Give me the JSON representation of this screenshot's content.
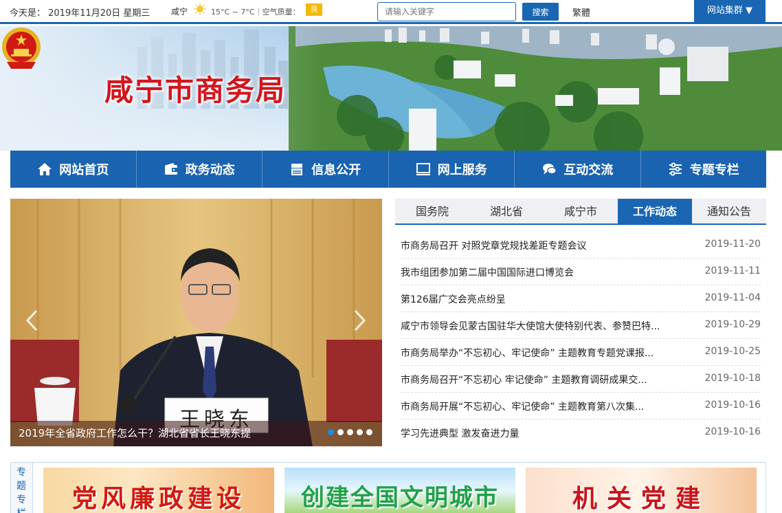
{
  "topbar": {
    "today": "今天是： 2019年11月20日 星期三",
    "city": "咸宁",
    "weather_icon": "sun-icon",
    "temp_aqi": "15°C ~ 7°C｜空气质量：",
    "aqi": "良",
    "search_placeholder": "请输入关键字",
    "search_button": "搜索",
    "traditional": "繁體",
    "site_group": "网站集群 ▼"
  },
  "banner": {
    "title": "咸宁市商务局"
  },
  "nav": [
    {
      "label": "网站首页",
      "icon": "home-icon"
    },
    {
      "label": "政务动态",
      "icon": "wallet-icon"
    },
    {
      "label": "信息公开",
      "icon": "server-icon"
    },
    {
      "label": "网上服务",
      "icon": "monitor-icon"
    },
    {
      "label": "互动交流",
      "icon": "chat-icon"
    },
    {
      "label": "专题专栏",
      "icon": "sliders-icon"
    }
  ],
  "slider": {
    "caption": "2019年全省政府工作怎么干？湖北省省长王晓东提",
    "nameplate": "王晓东",
    "active_index": 0,
    "count": 5
  },
  "tabs": [
    "国务院",
    "湖北省",
    "咸宁市",
    "工作动态",
    "通知公告"
  ],
  "active_tab": 3,
  "news": [
    {
      "title": "市商务局召开 对照党章党规找差距专题会议",
      "date": "2019-11-20"
    },
    {
      "title": "我市组团参加第二届中国国际进口博览会",
      "date": "2019-11-11"
    },
    {
      "title": "第126届广交会亮点纷呈",
      "date": "2019-11-04"
    },
    {
      "title": "咸宁市领导会见蒙古国驻华大使馆大使特别代表、参赞巴特...",
      "date": "2019-10-29"
    },
    {
      "title": "市商务局举办“不忘初心、牢记使命” 主题教育专题党课报...",
      "date": "2019-10-25"
    },
    {
      "title": "市商务局召开“不忘初心 牢记使命” 主题教育调研成果交...",
      "date": "2019-10-18"
    },
    {
      "title": "市商务局开展“不忘初心、牢记使命” 主题教育第八次集...",
      "date": "2019-10-16"
    },
    {
      "title": "学习先进典型 激发奋进力量",
      "date": "2019-10-16"
    }
  ],
  "special": {
    "label": "专题专栏",
    "promos": [
      "党风廉政建设",
      "创建全国文明城市",
      "机关党建"
    ]
  },
  "colors": {
    "primary": "#1b66b3",
    "title_red": "#d2161e",
    "aqi_badge": "#f5b800"
  }
}
